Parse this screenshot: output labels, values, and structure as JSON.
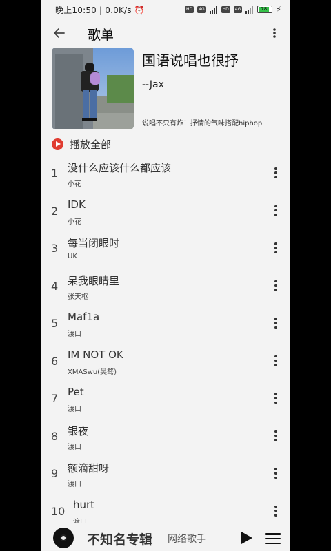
{
  "status_bar": {
    "time": "晚上10:50",
    "speed": "0.0K/s",
    "network_badges": [
      "HD",
      "4G",
      "HD",
      "4G"
    ],
    "battery": "78"
  },
  "header": {
    "title": "歌单"
  },
  "playlist": {
    "title": "国语说唱也很抒",
    "author": "--Jax",
    "description": "说唱不只有炸！抒情的气味搭配hiphop"
  },
  "play_all": {
    "label": "播放全部",
    "icon_color": "#e03c31"
  },
  "songs": [
    {
      "index": "1",
      "name": "没什么应该什么都应该",
      "artist": "小花"
    },
    {
      "index": "2",
      "name": "IDK",
      "artist": "小花"
    },
    {
      "index": "3",
      "name": "每当闭眼时",
      "artist": "UK"
    },
    {
      "index": "4",
      "name": "呆我眼睛里",
      "artist": "张天枢"
    },
    {
      "index": "5",
      "name": "Maf1a",
      "artist": "渡口"
    },
    {
      "index": "6",
      "name": "IM NOT OK",
      "artist": "XMASwu(吴骜)"
    },
    {
      "index": "7",
      "name": "Pet",
      "artist": "渡口"
    },
    {
      "index": "8",
      "name": "银夜",
      "artist": "渡口"
    },
    {
      "index": "9",
      "name": "额滴甜呀",
      "artist": "渡口"
    },
    {
      "index": "10",
      "name": "hurt",
      "artist": "渡口"
    }
  ],
  "mini_player": {
    "title": "不知名专辑",
    "artist": "网络歌手"
  }
}
